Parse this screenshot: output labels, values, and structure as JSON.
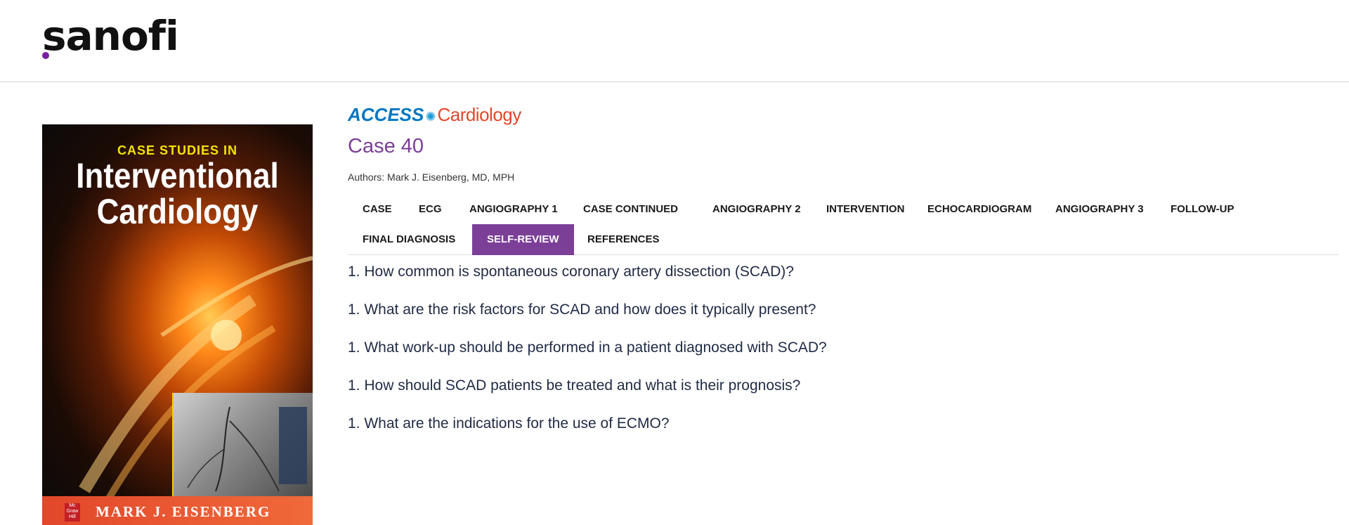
{
  "header": {
    "logo_text": "sanofi",
    "accent_color": "#7a1fa2"
  },
  "book": {
    "kicker": "CASE STUDIES IN",
    "title_line1": "Interventional",
    "title_line2": "Cardiology",
    "publisher_text": "Mc Graw Hill",
    "author": "MARK J. EISENBERG"
  },
  "brand": {
    "access": "ACCESS",
    "cardiology": "Cardiology"
  },
  "case": {
    "title": "Case 40",
    "authors": "Authors: Mark J. Eisenberg, MD, MPH"
  },
  "tabs": [
    {
      "label": "CASE"
    },
    {
      "label": "ECG"
    },
    {
      "label": "ANGIOGRAPHY 1"
    },
    {
      "label": "CASE CONTINUED"
    },
    {
      "label": "ANGIOGRAPHY 2"
    },
    {
      "label": "INTERVENTION"
    },
    {
      "label": "ECHOCARDIOGRAM"
    },
    {
      "label": "ANGIOGRAPHY 3"
    },
    {
      "label": "FOLLOW-UP"
    },
    {
      "label": "FINAL DIAGNOSIS"
    },
    {
      "label": "SELF-REVIEW",
      "active": true
    },
    {
      "label": "REFERENCES"
    }
  ],
  "questions": [
    "1. How common is spontaneous coronary artery dissection (SCAD)?",
    "1. What are the risk factors for SCAD and how does it typically present?",
    "1. What work-up should be performed in a patient diagnosed with SCAD?",
    "1. How should SCAD patients be treated and what is their prognosis?",
    "1. What are the indications for the use of ECMO?"
  ],
  "colors": {
    "case_title": "#7b3f98",
    "active_tab": "#7b3f98"
  }
}
